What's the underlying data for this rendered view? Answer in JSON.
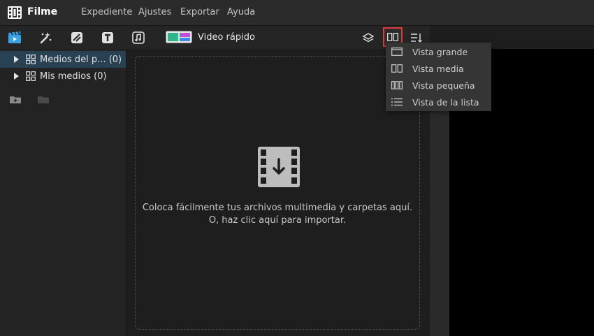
{
  "app": {
    "name": "Filme"
  },
  "menu": {
    "items": [
      {
        "label": "Expediente"
      },
      {
        "label": "Ajustes"
      },
      {
        "label": "Exportar"
      },
      {
        "label": "Ayuda"
      }
    ]
  },
  "toolbar": {
    "tabs": [
      {
        "icon": "media-clapper-icon",
        "active": true
      },
      {
        "icon": "effects-magic-icon"
      },
      {
        "icon": "transitions-icon"
      },
      {
        "icon": "text-icon"
      },
      {
        "icon": "audio-music-icon"
      }
    ],
    "quick_video_label": "Video rápido",
    "right_icons": [
      "layers-icon",
      "grid-view-icon",
      "sort-icon"
    ],
    "accent": "#e23a3a"
  },
  "sidebar": {
    "items": [
      {
        "label": "Medios del p... (0)",
        "selected": true
      },
      {
        "label": "Mis medios (0)",
        "selected": false
      }
    ]
  },
  "dropzone": {
    "line1": "Coloca fácilmente tus archivos multimedia y carpetas aquí.",
    "line2": "O, haz clic aquí para importar."
  },
  "view_menu": {
    "items": [
      {
        "label": "Vista grande",
        "icon": "large-view-icon"
      },
      {
        "label": "Vista media",
        "icon": "medium-view-icon"
      },
      {
        "label": "Vista pequeña",
        "icon": "small-view-icon"
      },
      {
        "label": "Vista de la lista",
        "icon": "list-view-icon"
      }
    ]
  }
}
